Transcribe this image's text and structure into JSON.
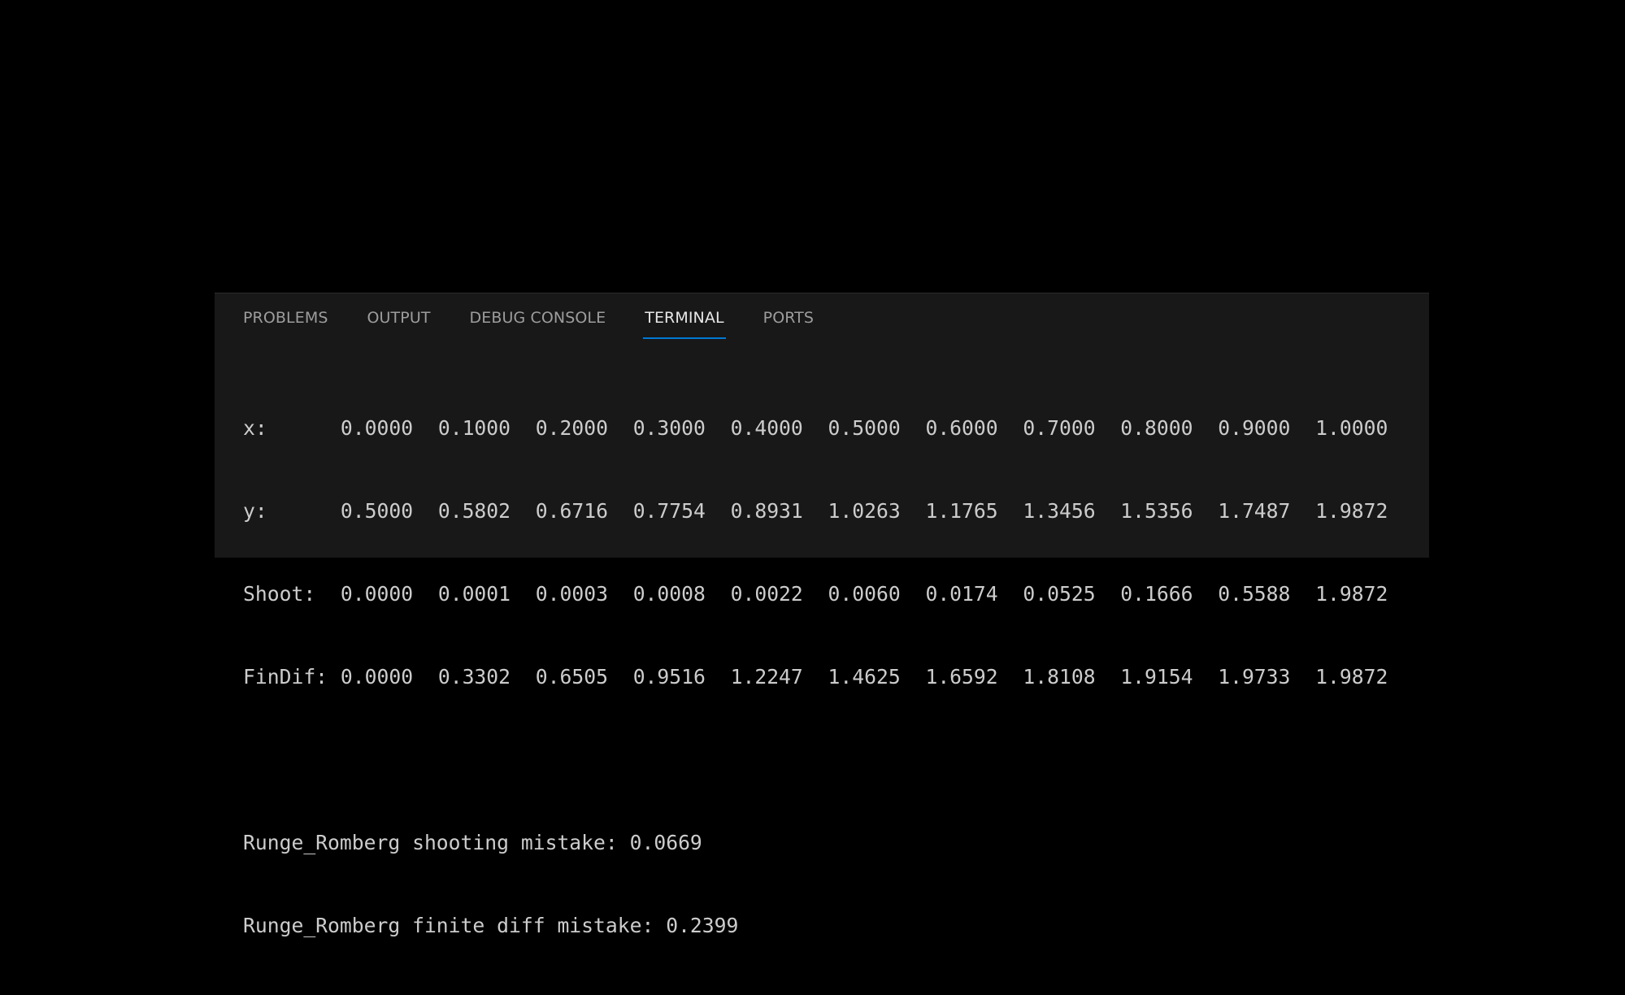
{
  "panel": {
    "tabs": [
      {
        "label": "PROBLEMS",
        "active": false
      },
      {
        "label": "OUTPUT",
        "active": false
      },
      {
        "label": "DEBUG CONSOLE",
        "active": false
      },
      {
        "label": "TERMINAL",
        "active": true
      },
      {
        "label": "PORTS",
        "active": false
      }
    ],
    "accent_color": "#0078d4"
  },
  "terminal": {
    "rows": [
      {
        "label": "x:",
        "values": [
          "0.0000",
          "0.1000",
          "0.2000",
          "0.3000",
          "0.4000",
          "0.5000",
          "0.6000",
          "0.7000",
          "0.8000",
          "0.9000",
          "1.0000"
        ]
      },
      {
        "label": "y:",
        "values": [
          "0.5000",
          "0.5802",
          "0.6716",
          "0.7754",
          "0.8931",
          "1.0263",
          "1.1765",
          "1.3456",
          "1.5356",
          "1.7487",
          "1.9872"
        ]
      },
      {
        "label": "Shoot:",
        "values": [
          "0.0000",
          "0.0001",
          "0.0003",
          "0.0008",
          "0.0022",
          "0.0060",
          "0.0174",
          "0.0525",
          "0.1666",
          "0.5588",
          "1.9872"
        ]
      },
      {
        "label": "FinDif:",
        "values": [
          "0.0000",
          "0.3302",
          "0.6505",
          "0.9516",
          "1.2247",
          "1.4625",
          "1.6592",
          "1.8108",
          "1.9154",
          "1.9733",
          "1.9872"
        ]
      }
    ],
    "messages": [
      "Runge_Romberg shooting mistake: 0.0669",
      "Runge_Romberg finite diff mistake: 0.2399"
    ]
  }
}
